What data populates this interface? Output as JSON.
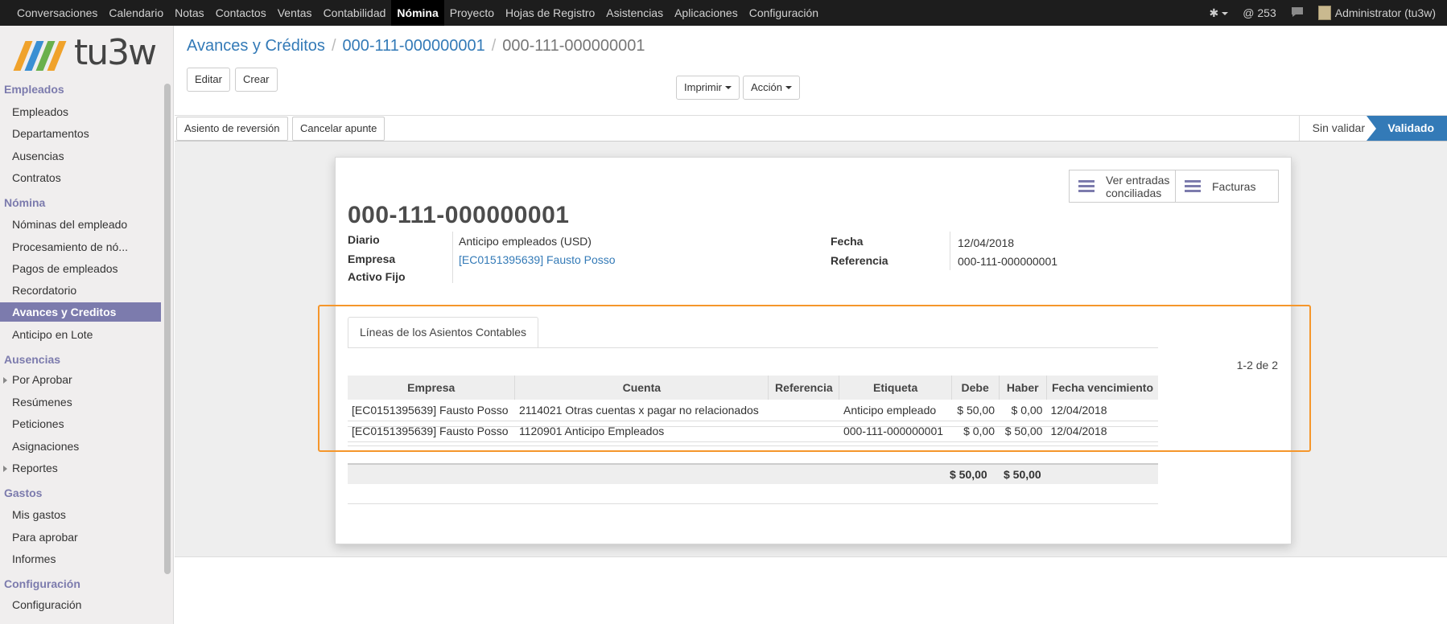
{
  "topbar": {
    "menu": [
      "Conversaciones",
      "Calendario",
      "Notas",
      "Contactos",
      "Ventas",
      "Contabilidad",
      "Nómina",
      "Proyecto",
      "Hojas de Registro",
      "Asistencias",
      "Aplicaciones",
      "Configuración"
    ],
    "active_menu": "Nómina",
    "notifications": "@ 253",
    "user": "Administrator (tu3w)"
  },
  "sidebar": {
    "logo_text": "tu3w",
    "sections": {
      "empleados": "Empleados",
      "nomina": "Nómina",
      "ausencias": "Ausencias",
      "gastos": "Gastos",
      "configuracion": "Configuración"
    },
    "items": {
      "empleados": "Empleados",
      "departamentos": "Departamentos",
      "ausencias": "Ausencias",
      "contratos": "Contratos",
      "nominas_empleado": "Nóminas del empleado",
      "procesamiento": "Procesamiento de nó...",
      "pagos": "Pagos de empleados",
      "recordatorio": "Recordatorio",
      "avances": "Avances y Creditos",
      "anticipo_lote": "Anticipo en Lote",
      "por_aprobar": "Por Aprobar",
      "resumenes": "Resúmenes",
      "peticiones": "Peticiones",
      "asignaciones": "Asignaciones",
      "reportes": "Reportes",
      "mis_gastos": "Mis gastos",
      "para_aprobar": "Para aprobar",
      "informes": "Informes",
      "configuracion": "Configuración"
    }
  },
  "breadcrumb": {
    "root": "Avances y Créditos",
    "middle": "000-111-000000001",
    "current": "000-111-000000001"
  },
  "buttons": {
    "edit": "Editar",
    "create": "Crear",
    "print": "Imprimir",
    "action": "Acción",
    "reverse_entry": "Asiento de reversión",
    "cancel_entry": "Cancelar apunte"
  },
  "status": {
    "inactive": "Sin validar",
    "active": "Validado"
  },
  "smart_buttons": {
    "reconciled_line1": "Ver entradas",
    "reconciled_line2": "conciliadas",
    "invoices": "Facturas"
  },
  "record": {
    "title": "000-111-000000001",
    "labels": {
      "diario": "Diario",
      "empresa": "Empresa",
      "activo_fijo": "Activo Fijo",
      "fecha": "Fecha",
      "referencia": "Referencia"
    },
    "values": {
      "diario": "Anticipo empleados (USD)",
      "empresa": "[EC0151395639] Fausto Posso",
      "fecha": "12/04/2018",
      "referencia": "000-111-000000001"
    }
  },
  "tab": {
    "label": "Líneas de los Asientos Contables",
    "pager": "1-2 de 2"
  },
  "table": {
    "headers": [
      "Empresa",
      "Cuenta",
      "Referencia",
      "Etiqueta",
      "Debe",
      "Haber",
      "Fecha vencimiento"
    ],
    "rows": [
      [
        "[EC0151395639] Fausto Posso",
        "2114021 Otras cuentas x pagar no relacionados",
        "",
        "Anticipo empleado",
        "$ 50,00",
        "$ 0,00",
        "12/04/2018"
      ],
      [
        "[EC0151395639] Fausto Posso",
        "1120901 Anticipo Empleados",
        "",
        "000-111-000000001",
        "$ 0,00",
        "$ 50,00",
        "12/04/2018"
      ]
    ],
    "totals": {
      "debe": "$ 50,00",
      "haber": "$ 50,00"
    }
  },
  "colors": {
    "topbar": "#1d1d1d",
    "accent": "#7c7bad",
    "link": "#337ab7",
    "highlight": "#f5962b"
  }
}
